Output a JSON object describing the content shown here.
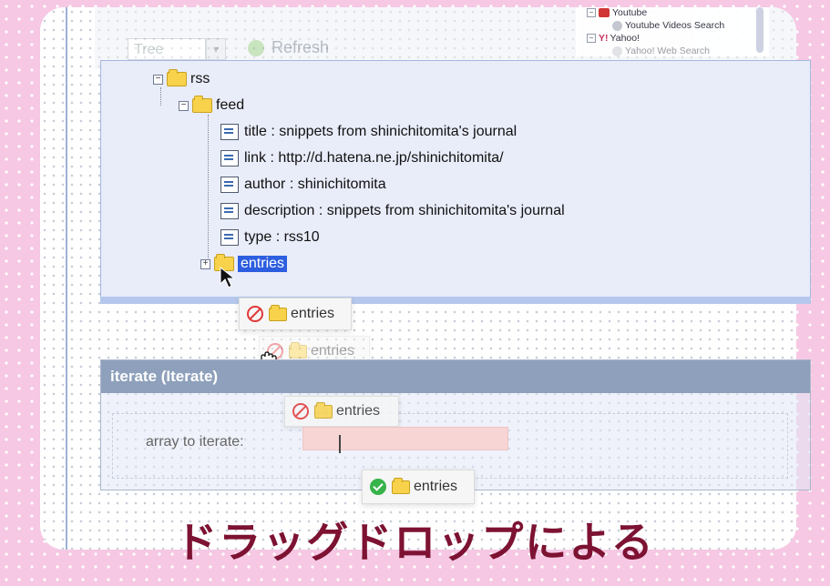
{
  "toolbar": {
    "view_select_value": "Tree",
    "refresh_label": "Refresh"
  },
  "services": {
    "youtube_label": "Youtube",
    "youtube_child_label": "Youtube Videos Search",
    "yahoo_label": "Yahoo!",
    "yahoo_child_label": "Yahoo! Web Search"
  },
  "tree": {
    "root_label": "rss",
    "feed_label": "feed",
    "leaves": [
      "title : snippets from shinichitomita's journal",
      "link : http://d.hatena.ne.jp/shinichitomita/",
      "author : shinichitomita",
      "description : snippets from shinichitomita's journal",
      "type : rss10"
    ],
    "entries_label": "entries"
  },
  "drag": {
    "ghost_label": "entries"
  },
  "iterate": {
    "title": "iterate (Iterate)",
    "field_label": "array to iterate:"
  },
  "caption": "ドラッグドロップによる"
}
